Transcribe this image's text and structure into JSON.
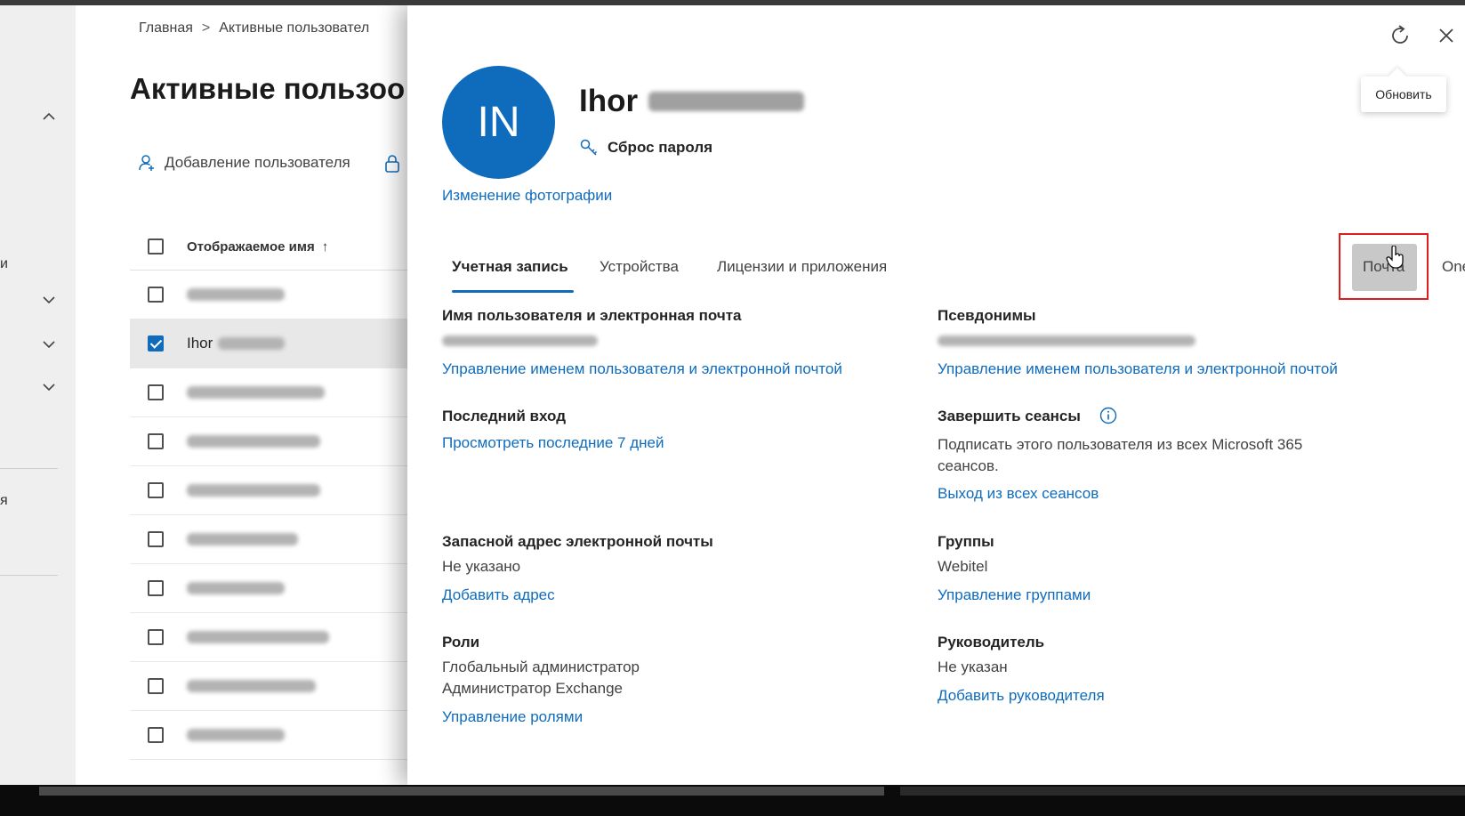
{
  "breadcrumb": {
    "home": "Главная",
    "current": "Активные пользовател"
  },
  "page": {
    "title": "Активные пользоо",
    "add_user": "Добавление пользователя",
    "column_display_name": "Отображаемое имя",
    "sort_arrow": "↑",
    "selected_user_first_name": "Ihor"
  },
  "leftnav": {
    "frag1": "и",
    "frag2": "я"
  },
  "panel": {
    "avatar_initials": "IN",
    "user_first_name": "Ihor",
    "reset_password": "Сброс пароля",
    "change_photo": "Изменение фотографии",
    "tooltip_refresh": "Обновить",
    "tabs": [
      {
        "label": "Учетная запись"
      },
      {
        "label": "Устройства"
      },
      {
        "label": "Лицензии и приложения"
      },
      {
        "label": "Почта"
      },
      {
        "label": "OneDrive"
      }
    ],
    "sections": {
      "username_email": {
        "title": "Имя пользователя и электронная почта",
        "link": "Управление именем пользователя и электронной почтой"
      },
      "aliases": {
        "title": "Псевдонимы",
        "link": "Управление именем пользователя и электронной почтой"
      },
      "last_sign_in": {
        "title": "Последний вход",
        "link": "Просмотреть последние 7 дней"
      },
      "sign_out": {
        "title": "Завершить сеансы",
        "text_line1": "Подписать этого пользователя из всех Microsoft 365",
        "text_line2": "сеансов.",
        "link": "Выход из всех сеансов"
      },
      "alt_email": {
        "title": "Запасной адрес электронной почты",
        "value": "Не указано",
        "link": "Добавить адрес"
      },
      "groups": {
        "title": "Группы",
        "value": "Webitel",
        "link": "Управление группами"
      },
      "roles": {
        "title": "Роли",
        "value_line1": "Глобальный администратор",
        "value_line2": "Администратор Exchange",
        "link": "Управление ролями"
      },
      "manager": {
        "title": "Руководитель",
        "value": "Не указан",
        "link": "Добавить руководителя"
      }
    }
  },
  "colors": {
    "accent": "#0f6cbd",
    "highlight_border": "#e21b1b",
    "text": "#242424"
  }
}
